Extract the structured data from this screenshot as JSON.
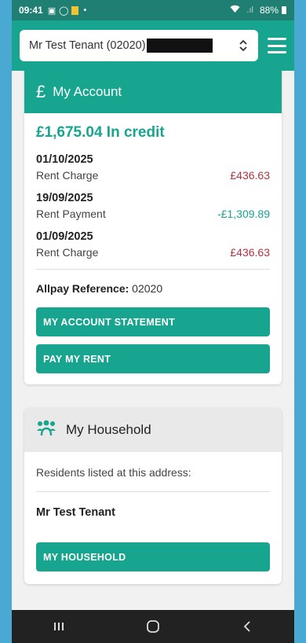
{
  "status_bar": {
    "time": "09:41",
    "battery": "88%"
  },
  "header": {
    "tenant_select_value": "Mr Test Tenant (02020)"
  },
  "account": {
    "title": "My Account",
    "balance": "£1,675.04 In credit",
    "transactions": [
      {
        "date": "01/10/2025",
        "type": "Rent Charge",
        "amount": "£436.63",
        "kind": "charge"
      },
      {
        "date": "19/09/2025",
        "type": "Rent Payment",
        "amount": "-£1,309.89",
        "kind": "payment"
      },
      {
        "date": "01/09/2025",
        "type": "Rent Charge",
        "amount": "£436.63",
        "kind": "charge"
      }
    ],
    "allpay_label": "Allpay Reference:",
    "allpay_value": "02020",
    "statement_button": "MY ACCOUNT STATEMENT",
    "pay_button": "PAY MY RENT"
  },
  "household": {
    "title": "My Household",
    "residents_label": "Residents listed at this address:",
    "resident_name": "Mr Test Tenant",
    "button": "MY HOUSEHOLD"
  },
  "colors": {
    "brand_teal": "#18a58f",
    "charge_red": "#b0343f",
    "frame_blue": "#4aa9d2"
  },
  "icons": {
    "account": "pound-icon",
    "household": "people-icon",
    "menu": "hamburger-icon",
    "select": "chevron-updown-icon"
  }
}
